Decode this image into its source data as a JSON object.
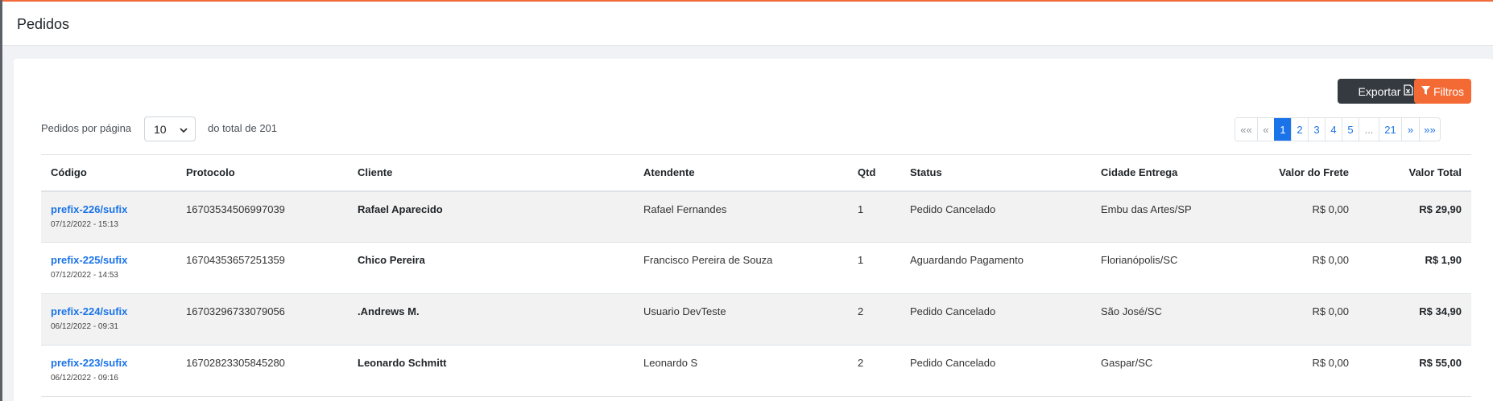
{
  "header": {
    "title": "Pedidos"
  },
  "toolbar": {
    "export_label": "Exportar",
    "filter_label": "Filtros",
    "export_icon": "excel-file-icon",
    "filter_icon": "filter-icon"
  },
  "perpage": {
    "label": "Pedidos por página",
    "value": "10",
    "total_label": "do total de 201"
  },
  "pagination": {
    "first": "««",
    "prev": "«",
    "pages": [
      "1",
      "2",
      "3",
      "4",
      "5"
    ],
    "ellipsis": "...",
    "last_page": "21",
    "next": "»",
    "last": "»»",
    "active": "1"
  },
  "table": {
    "headers": {
      "codigo": "Código",
      "protocolo": "Protocolo",
      "cliente": "Cliente",
      "atendente": "Atendente",
      "qtd": "Qtd",
      "status": "Status",
      "cidade": "Cidade Entrega",
      "frete": "Valor do Frete",
      "total": "Valor Total"
    },
    "rows": [
      {
        "codigo": "prefix-226/sufix",
        "data": "07/12/2022 - 15:13",
        "protocolo": "16703534506997039",
        "cliente": "Rafael Aparecido",
        "atendente": "Rafael Fernandes",
        "qtd": "1",
        "status": "Pedido Cancelado",
        "cidade": "Embu das Artes/SP",
        "frete": "R$ 0,00",
        "total": "R$ 29,90"
      },
      {
        "codigo": "prefix-225/sufix",
        "data": "07/12/2022 - 14:53",
        "protocolo": "16704353657251359",
        "cliente": "Chico Pereira",
        "atendente": "Francisco Pereira de Souza",
        "qtd": "1",
        "status": "Aguardando Pagamento",
        "cidade": "Florianópolis/SC",
        "frete": "R$ 0,00",
        "total": "R$ 1,90"
      },
      {
        "codigo": "prefix-224/sufix",
        "data": "06/12/2022 - 09:31",
        "protocolo": "16703296733079056",
        "cliente": ".Andrews M.",
        "atendente": "Usuario DevTeste",
        "qtd": "2",
        "status": "Pedido Cancelado",
        "cidade": "São José/SC",
        "frete": "R$ 0,00",
        "total": "R$ 34,90"
      },
      {
        "codigo": "prefix-223/sufix",
        "data": "06/12/2022 - 09:16",
        "protocolo": "16702823305845280",
        "cliente": "Leonardo Schmitt",
        "atendente": "Leonardo S",
        "qtd": "2",
        "status": "Pedido Cancelado",
        "cidade": "Gaspar/SC",
        "frete": "R$ 0,00",
        "total": "R$ 55,00"
      }
    ]
  },
  "colors": {
    "accent_orange": "#f46a35",
    "link_blue": "#1a73e8",
    "dark_button": "#343a40"
  }
}
